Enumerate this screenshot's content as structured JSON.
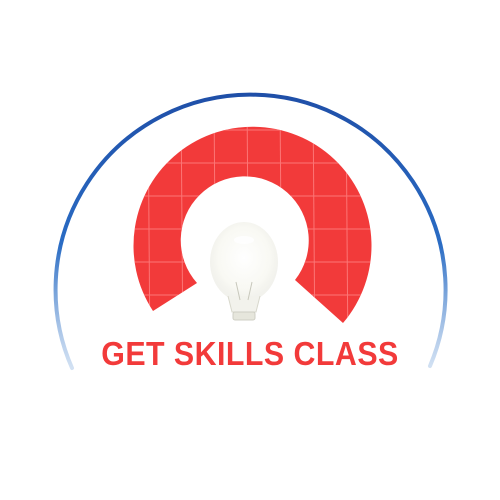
{
  "logo": {
    "brand_name": "GET SKILLS CLASS",
    "icon": "lightbulb-icon",
    "colors": {
      "outer_arc": "#1f5fb0",
      "ring": "#f23a3a",
      "ring_grid": "#ff7a7a",
      "text": "#f23a3a",
      "background": "#ffffff"
    }
  }
}
